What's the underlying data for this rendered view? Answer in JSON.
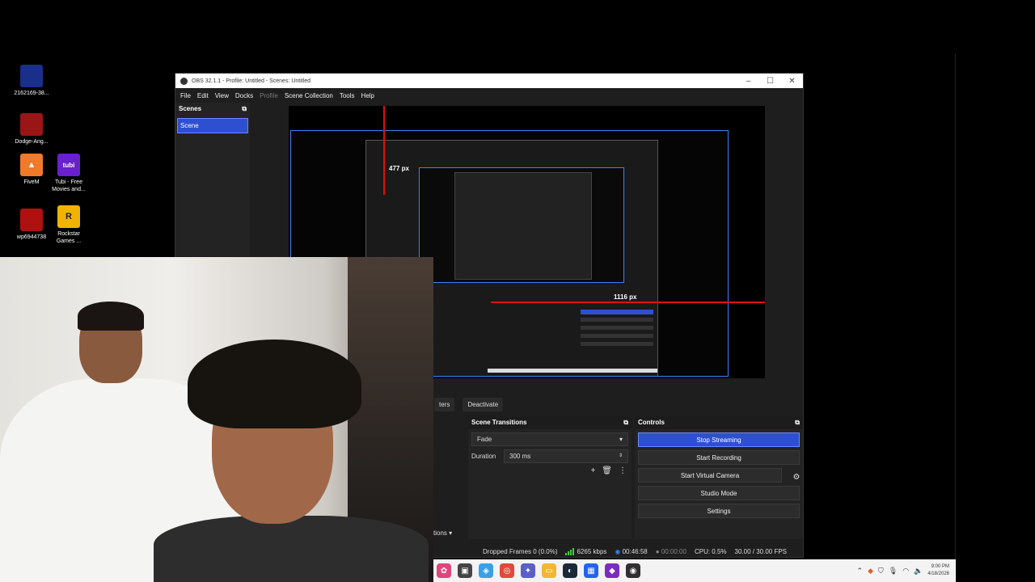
{
  "desktop": {
    "icons": [
      {
        "label": "2162169-38...",
        "color": "#1a2f8a"
      },
      {
        "label": "Dodge-Ang...",
        "color": "#9a1515"
      },
      {
        "label": "FiveM",
        "color": "#f07a2a"
      },
      {
        "label": "Tubi - Free Movies and...",
        "color": "#6a1fd1",
        "glyph": "tubi"
      },
      {
        "label": "wp6944738",
        "color": "#b01010"
      },
      {
        "label": "Rockstar Games ...",
        "color": "#f0b400",
        "glyph": "R"
      }
    ]
  },
  "obs": {
    "title": "OBS 32.1.1 - Profile: Untitled - Scenes: Untitled",
    "menu": [
      "File",
      "Edit",
      "View",
      "Docks",
      "Profile",
      "Scene Collection",
      "Tools",
      "Help"
    ],
    "scenes_title": "Scenes",
    "scene_item": "Scene",
    "preview": {
      "label_top": "477 px",
      "label_right": "1116 px"
    },
    "toolbar": {
      "filters": "ters",
      "deactivate": "Deactivate"
    },
    "transitions": {
      "title": "Scene Transitions",
      "selected": "Fade",
      "duration_label": "Duration",
      "duration_value": "300 ms",
      "bottom_label": "tions"
    },
    "controls": {
      "title": "Controls",
      "stop_streaming": "Stop Streaming",
      "start_recording": "Start Recording",
      "start_virtual_camera": "Start Virtual Camera",
      "studio_mode": "Studio Mode",
      "settings": "Settings"
    },
    "status": {
      "dropped": "Dropped Frames 0 (0.0%)",
      "bitrate": "6265 kbps",
      "stream_time": "00:46:58",
      "rec_time": "00:00:00",
      "cpu": "CPU: 0.5%",
      "fps": "30.00 / 30.00 FPS"
    }
  },
  "taskbar": {
    "time": "9:00 PM",
    "date": "4/18/2026"
  }
}
